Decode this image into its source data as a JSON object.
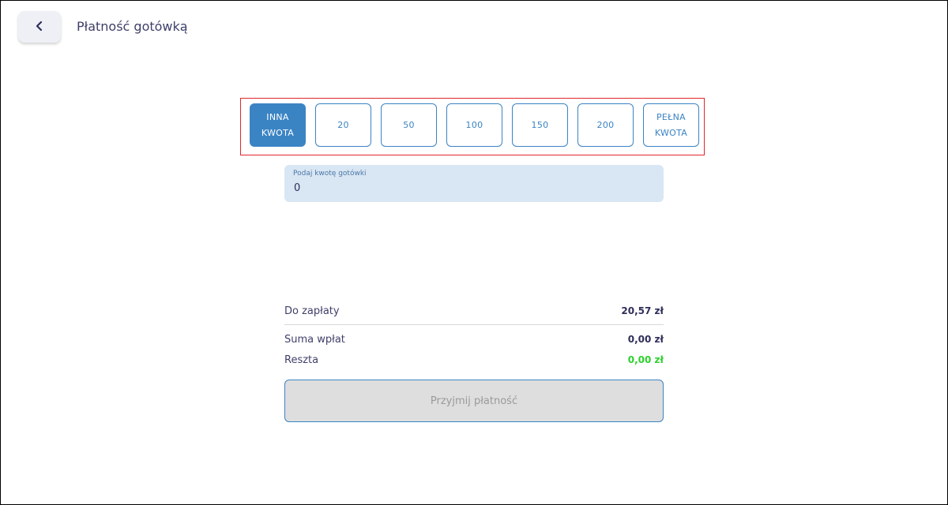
{
  "header": {
    "back_icon": "chevron-left-icon",
    "title": "Płatność gotówką"
  },
  "amount_options": [
    {
      "label": "INNA\nKWOTA",
      "active": true
    },
    {
      "label": "20",
      "active": false
    },
    {
      "label": "50",
      "active": false
    },
    {
      "label": "100",
      "active": false
    },
    {
      "label": "150",
      "active": false
    },
    {
      "label": "200",
      "active": false
    },
    {
      "label": "PEŁNA\nKWOTA",
      "active": false
    }
  ],
  "cash_input": {
    "label": "Podaj kwotę gotówki",
    "value": "0"
  },
  "summary": {
    "to_pay_label": "Do zapłaty",
    "to_pay_value": "20,57 zł",
    "paid_label": "Suma wpłat",
    "paid_value": "0,00 zł",
    "change_label": "Reszta",
    "change_value": "0,00 zł"
  },
  "accept_button": {
    "label": "Przyjmij płatność",
    "disabled": true
  },
  "colors": {
    "accent": "#3b84c4",
    "change_green": "#2ed12e",
    "highlight_red": "#e0262b",
    "field_bg": "#d9e6f3"
  }
}
